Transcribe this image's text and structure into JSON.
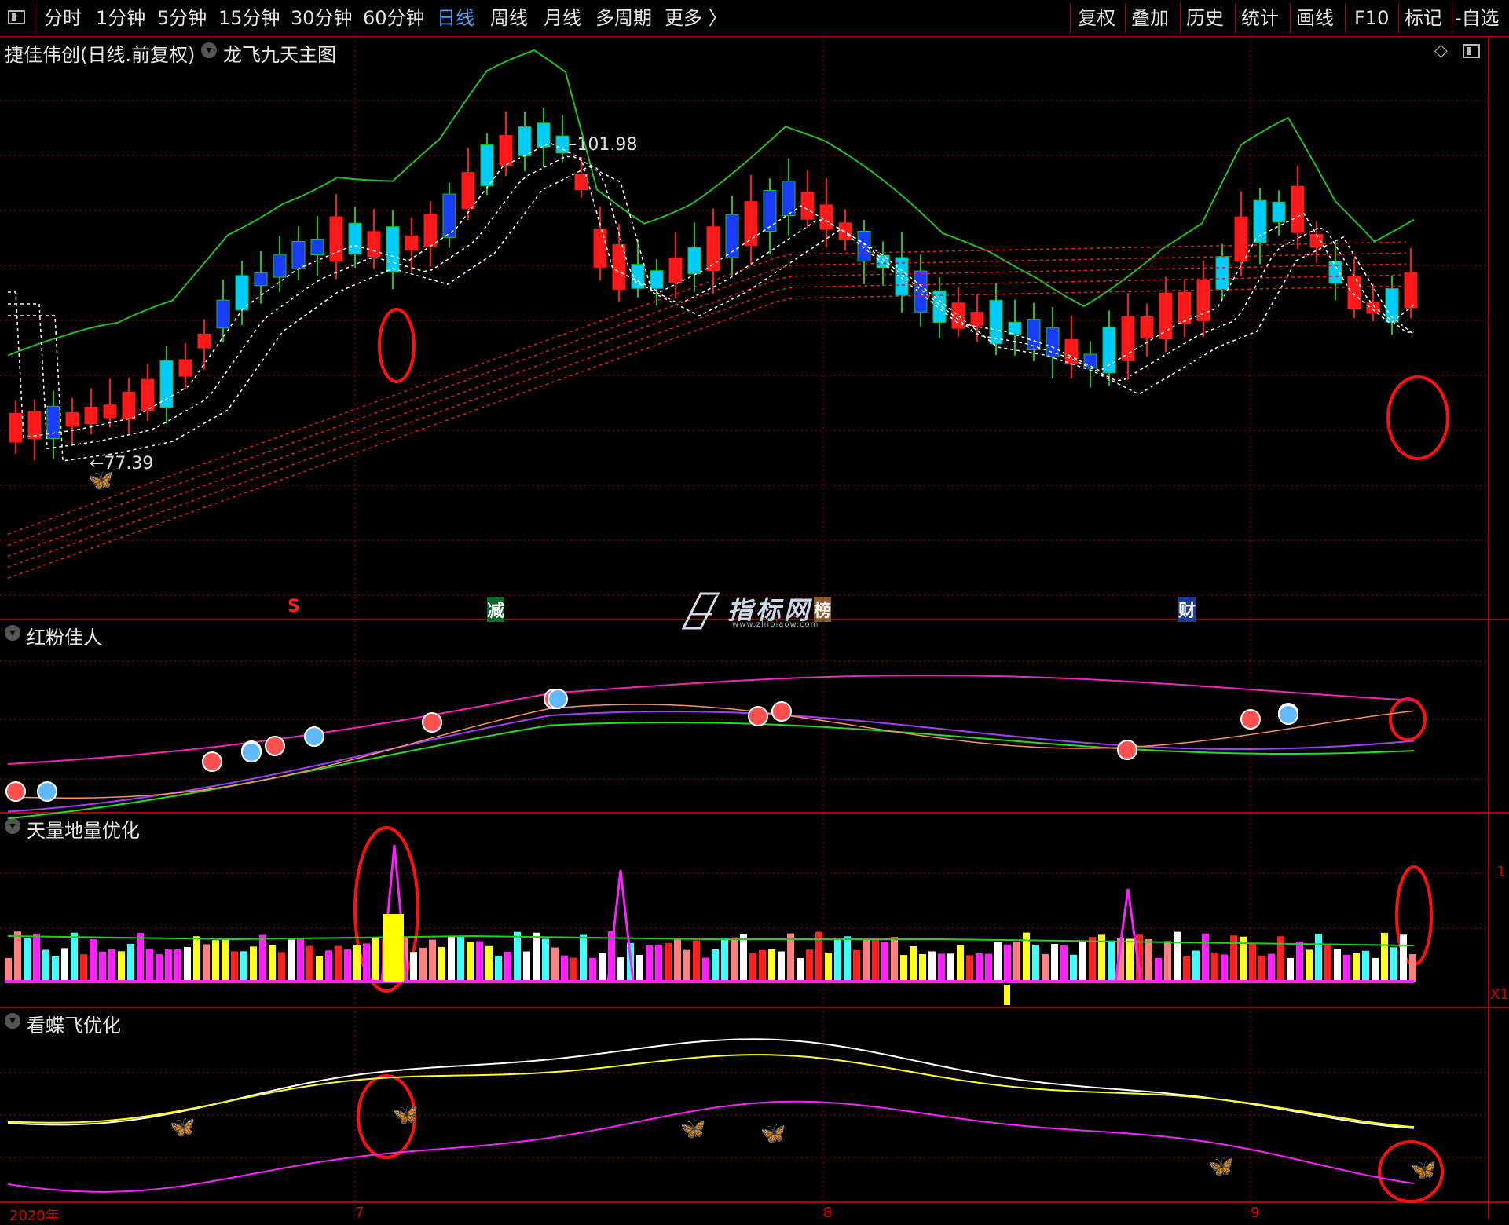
{
  "toolbar": {
    "periods": [
      "分时",
      "1分钟",
      "5分钟",
      "15分钟",
      "30分钟",
      "60分钟",
      "日线",
      "周线",
      "月线",
      "多周期",
      "更多 〉"
    ],
    "active_period": "日线",
    "actions": [
      "复权",
      "叠加",
      "历史",
      "统计",
      "画线",
      "F10",
      "标记",
      "-自选"
    ]
  },
  "main_chart": {
    "stock_title": "捷佳伟创(日线.前复权)",
    "indicator_name": "龙飞九天主图",
    "high_label": "101.98",
    "low_label": "77.39",
    "event_markers": [
      "S",
      "减",
      "榜",
      "财"
    ]
  },
  "panels": {
    "panel1_title": "红粉佳人",
    "panel2_title": "天量地量优化",
    "panel3_title": "看蝶飞优化"
  },
  "axis": {
    "year_label": "2020年",
    "month_labels": [
      "7",
      "8",
      "9"
    ],
    "right_value": "1",
    "right_unit": "X1"
  },
  "watermark": {
    "text": "指标网",
    "url": "www.zhibiaow.com"
  },
  "colors": {
    "up": "#ff1a1a",
    "down": "#1a3cff",
    "green": "#19c519",
    "magenta": "#ff22ff",
    "grid": "#b00000"
  }
}
